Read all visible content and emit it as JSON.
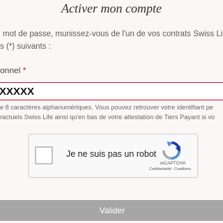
{
  "page": {
    "title": "Activer mon compte",
    "intro_line1": "mot de passe, munissez-vous de l'un de vos contrats Swiss Life",
    "intro_line2": "s (*) suivants :"
  },
  "form": {
    "id_label": "onnel",
    "required_mark": "*",
    "id_value": "XXXXX",
    "hint_line1": "e 8 caractères alphanumériques. Vous pouvez retrouver votre identifiant pe",
    "hint_line2": "ractuels Swiss Life ainsi qu'en bas de votre attestation de Tiers Payant si vo"
  },
  "recaptcha": {
    "label": "Je ne suis pas un robot",
    "brand": "reCAPTCHA",
    "links": "Confidentialité - Conditions"
  },
  "submit": {
    "label": "Valider"
  },
  "colors": {
    "accent": "#c8102e",
    "button": "#a7a6a6",
    "background": "#fcf7f7"
  }
}
